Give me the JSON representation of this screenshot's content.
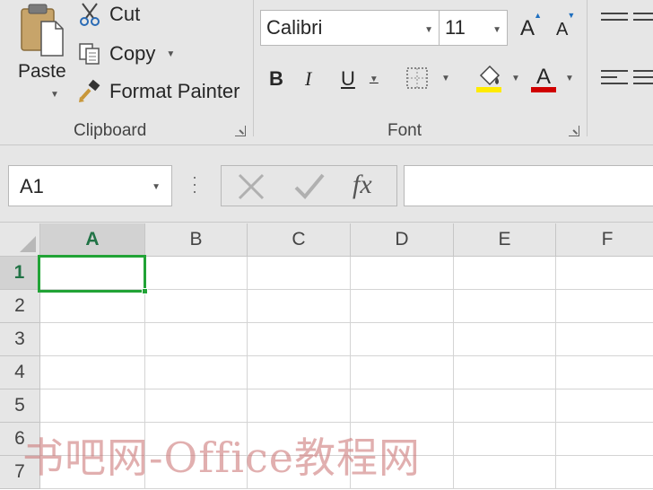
{
  "ribbon": {
    "clipboard": {
      "paste_label": "Paste",
      "cut_label": "Cut",
      "copy_label": "Copy",
      "format_painter_label": "Format Painter",
      "group_label": "Clipboard"
    },
    "font": {
      "font_name": "Calibri",
      "font_size": "11",
      "grow_label": "A",
      "shrink_label": "A",
      "bold_label": "B",
      "italic_label": "I",
      "underline_label": "U",
      "font_color_label": "A",
      "group_label": "Font",
      "highlight_color": "#ffeb00",
      "font_color": "#d00000"
    }
  },
  "formula_bar": {
    "name_box": "A1",
    "fx_label": "fx",
    "formula_value": ""
  },
  "grid": {
    "columns": [
      "A",
      "B",
      "C",
      "D",
      "E",
      "F"
    ],
    "rows": [
      "1",
      "2",
      "3",
      "4",
      "5",
      "6",
      "7"
    ],
    "active_cell": "A1",
    "accent_color": "#217346"
  },
  "watermark": "书吧网-Office教程网"
}
